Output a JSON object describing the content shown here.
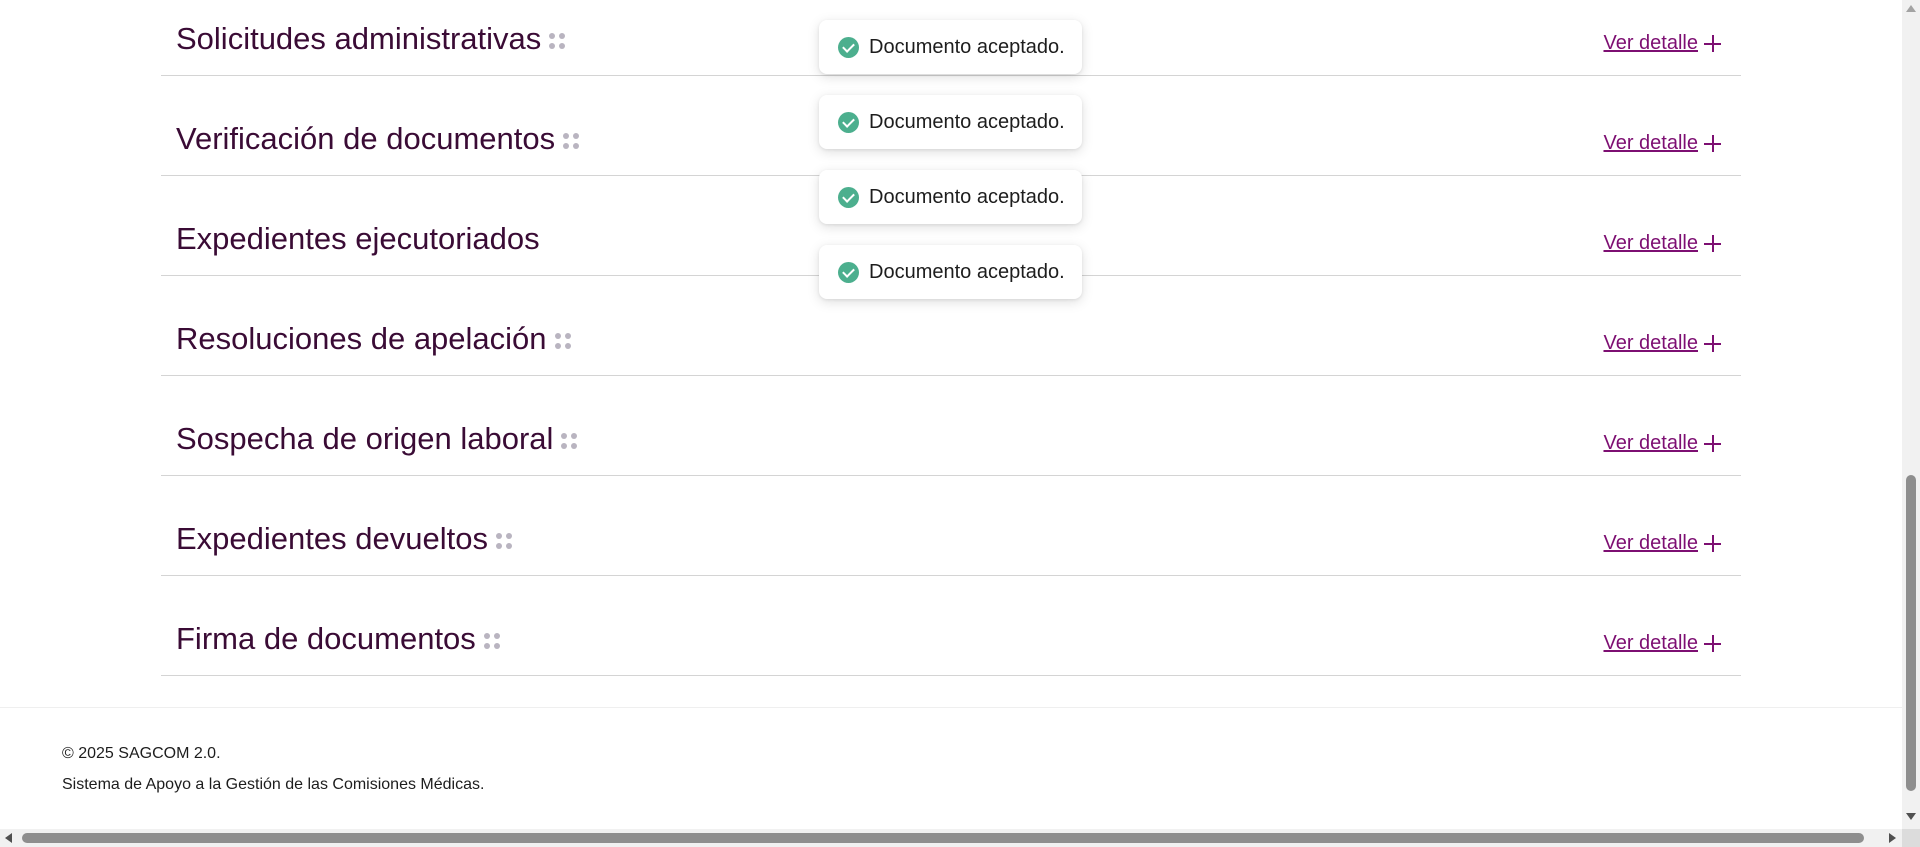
{
  "sections": [
    {
      "title": "Solicitudes administrativas",
      "has_drag_handle": true,
      "link_label": "Ver detalle"
    },
    {
      "title": "Verificación de documentos",
      "has_drag_handle": true,
      "link_label": "Ver detalle"
    },
    {
      "title": "Expedientes ejecutoriados",
      "has_drag_handle": false,
      "link_label": "Ver detalle"
    },
    {
      "title": "Resoluciones de apelación",
      "has_drag_handle": true,
      "link_label": "Ver detalle"
    },
    {
      "title": "Sospecha de origen laboral",
      "has_drag_handle": true,
      "link_label": "Ver detalle"
    },
    {
      "title": "Expedientes devueltos",
      "has_drag_handle": true,
      "link_label": "Ver detalle"
    },
    {
      "title": "Firma de documentos",
      "has_drag_handle": true,
      "link_label": "Ver detalle"
    }
  ],
  "toasts": [
    {
      "message": "Documento aceptado.",
      "icon": "check-circle-icon"
    },
    {
      "message": "Documento aceptado.",
      "icon": "check-circle-icon"
    },
    {
      "message": "Documento aceptado.",
      "icon": "check-circle-icon"
    },
    {
      "message": "Documento aceptado.",
      "icon": "check-circle-icon"
    }
  ],
  "footer": {
    "copyright": "© 2025 SAGCOM 2.0.",
    "description": "Sistema de Apoyo a la Gestión de las Comisiones Médicas."
  },
  "colors": {
    "title": "#3a0b35",
    "link": "#7d0f72",
    "drag_dots": "#b9b4c0",
    "success": "#4caf8e",
    "divider": "#d4d4d4"
  },
  "icons": {
    "drag": "drag-handle-icon",
    "link_suffix": "plus-icon",
    "toast": "check-circle-icon"
  }
}
